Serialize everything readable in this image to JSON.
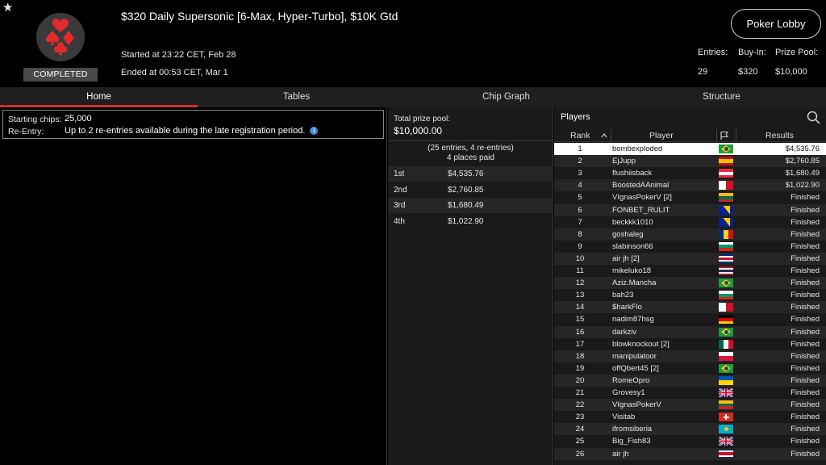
{
  "header": {
    "title": "$320 Daily Supersonic [6-Max, Hyper-Turbo], $10K Gtd",
    "status_badge": "COMPLETED",
    "started": "Started at 23:22 CET, Feb 28",
    "ended": "Ended at 00:53 CET, Mar 1",
    "lobby_button": "Poker Lobby",
    "stats": [
      {
        "label": "Entries:",
        "value": "29"
      },
      {
        "label": "Buy-In:",
        "value": "$320"
      },
      {
        "label": "Prize Pool:",
        "value": "$10,000"
      }
    ]
  },
  "tabs": [
    {
      "label": "Home",
      "active": true
    },
    {
      "label": "Tables",
      "active": false
    },
    {
      "label": "Chip Graph",
      "active": false
    },
    {
      "label": "Structure",
      "active": false
    }
  ],
  "info": {
    "starting_chips_label": "Starting chips:",
    "starting_chips_value": "25,000",
    "reentry_label": "Re-Entry:",
    "reentry_value": "Up to 2 re-entries available during the late registration period."
  },
  "prize": {
    "label": "Total prize pool:",
    "value": "$10,000.00",
    "entries_text": "(25 entries, 4 re-entries)",
    "places_text": "4 places paid",
    "places": [
      {
        "pos": "1st",
        "amount": "$4,535.76"
      },
      {
        "pos": "2nd",
        "amount": "$2,760.85"
      },
      {
        "pos": "3rd",
        "amount": "$1,680.49"
      },
      {
        "pos": "4th",
        "amount": "$1,022.90"
      }
    ]
  },
  "players": {
    "title": "Players",
    "columns": {
      "rank": "Rank",
      "player": "Player",
      "results": "Results"
    },
    "rows": [
      {
        "rank": "1",
        "name": "bombexploded",
        "flag": "br",
        "result": "$4,535.76"
      },
      {
        "rank": "2",
        "name": "EjJupp",
        "flag": "es",
        "result": "$2,760.85"
      },
      {
        "rank": "3",
        "name": "flushiisback",
        "flag": "at",
        "result": "$1,680.49"
      },
      {
        "rank": "4",
        "name": "BoostedAAnimal",
        "flag": "mt",
        "result": "$1,022.90"
      },
      {
        "rank": "5",
        "name": "VIgnasPokerV [2]",
        "flag": "lt",
        "result": "Finished"
      },
      {
        "rank": "6",
        "name": "FONBET_RULIT",
        "flag": "ba",
        "result": "Finished"
      },
      {
        "rank": "7",
        "name": "beckkk1010",
        "flag": "ba",
        "result": "Finished"
      },
      {
        "rank": "8",
        "name": "goshaleg",
        "flag": "ro",
        "result": "Finished"
      },
      {
        "rank": "9",
        "name": "slabinson66",
        "flag": "bg",
        "result": "Finished"
      },
      {
        "rank": "10",
        "name": "air jh [2]",
        "flag": "cr",
        "result": "Finished"
      },
      {
        "rank": "11",
        "name": "mikeluko18",
        "flag": "th",
        "result": "Finished"
      },
      {
        "rank": "12",
        "name": "Aziz.Mancha",
        "flag": "br",
        "result": "Finished"
      },
      {
        "rank": "13",
        "name": "bah23",
        "flag": "bg",
        "result": "Finished"
      },
      {
        "rank": "14",
        "name": "$harkFlo",
        "flag": "mt",
        "result": "Finished"
      },
      {
        "rank": "15",
        "name": "nadim87hsg",
        "flag": "de",
        "result": "Finished"
      },
      {
        "rank": "16",
        "name": "darkziv",
        "flag": "br",
        "result": "Finished"
      },
      {
        "rank": "17",
        "name": "blowknockout [2]",
        "flag": "mx",
        "result": "Finished"
      },
      {
        "rank": "18",
        "name": "manipulatoor",
        "flag": "pl",
        "result": "Finished"
      },
      {
        "rank": "19",
        "name": "offQbert45 [2]",
        "flag": "br",
        "result": "Finished"
      },
      {
        "rank": "20",
        "name": "RomeOpro",
        "flag": "ua",
        "result": "Finished"
      },
      {
        "rank": "21",
        "name": "Grovesy1",
        "flag": "gb",
        "result": "Finished"
      },
      {
        "rank": "22",
        "name": "VIgnasPokerV",
        "flag": "lt",
        "result": "Finished"
      },
      {
        "rank": "23",
        "name": "Visitab",
        "flag": "ch",
        "result": "Finished"
      },
      {
        "rank": "24",
        "name": "ifromsiberia",
        "flag": "kz",
        "result": "Finished"
      },
      {
        "rank": "25",
        "name": "Big_Fish83",
        "flag": "gb",
        "result": "Finished"
      },
      {
        "rank": "26",
        "name": "air jh",
        "flag": "cr",
        "result": "Finished"
      }
    ]
  },
  "colors": {
    "accent": "#d32f2f",
    "background": "#000000",
    "panel": "#1a1a1a",
    "info_icon": "#3d8bd9"
  },
  "icons": {
    "star": "star-icon",
    "logo": "poker-suits-logo",
    "search": "search-icon",
    "flag_header": "flag-icon",
    "sort": "sort-arrow-icon",
    "info": "info-icon"
  }
}
